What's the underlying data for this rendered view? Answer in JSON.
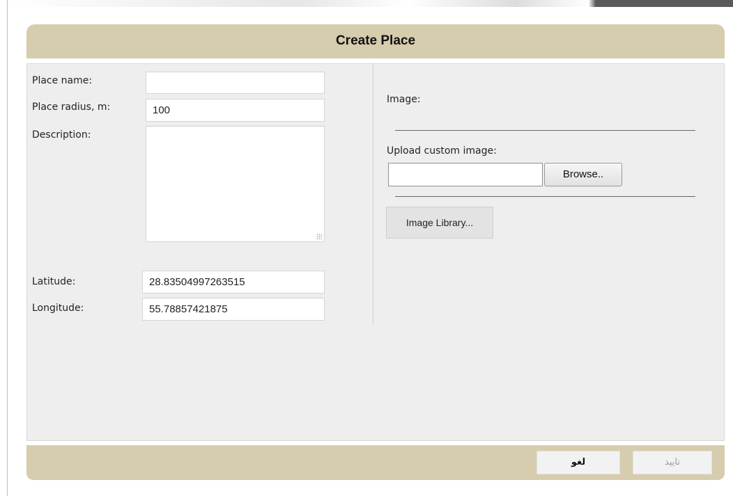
{
  "dialog": {
    "title": "Create Place"
  },
  "form": {
    "place_name_label": "Place name:",
    "place_name_value": "",
    "place_radius_label": "Place radius, m:",
    "place_radius_value": "100",
    "description_label": "Description:",
    "description_value": "",
    "latitude_label": "Latitude:",
    "latitude_value": "28.83504997263515",
    "longitude_label": "Longitude:",
    "longitude_value": "55.78857421875"
  },
  "image_panel": {
    "image_label": "Image:",
    "upload_label": "Upload custom image:",
    "file_value": "",
    "browse_label": "Browse..",
    "library_label": "Image Library..."
  },
  "footer": {
    "cancel_label": "لغو",
    "confirm_label": "تایید"
  }
}
